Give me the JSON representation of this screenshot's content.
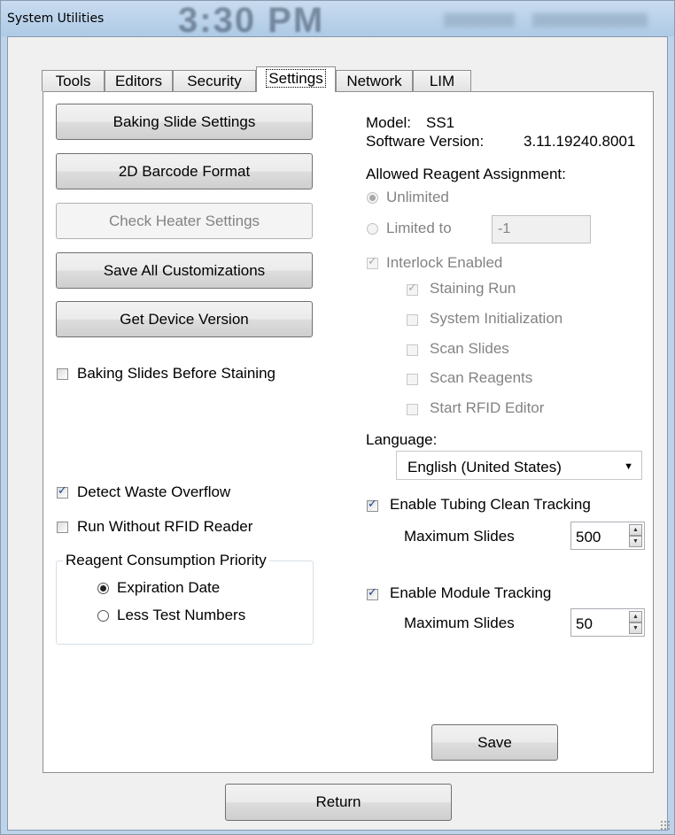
{
  "window": {
    "title": "System Utilities",
    "background_clock": "3:30 PM"
  },
  "tabs": [
    "Tools",
    "Editors",
    "Security",
    "Settings",
    "Network",
    "LIM"
  ],
  "active_tab": "Settings",
  "left": {
    "buttons": {
      "baking_slide_settings": "Baking Slide Settings",
      "barcode_format": "2D Barcode Format",
      "check_heater_settings": "Check Heater Settings",
      "save_all_customizations": "Save All Customizations",
      "get_device_version": "Get Device Version"
    },
    "checkboxes": {
      "baking_slides_before_staining": {
        "label": "Baking Slides Before Staining",
        "checked": false
      },
      "detect_waste_overflow": {
        "label": "Detect Waste Overflow",
        "checked": true
      },
      "run_without_rfid_reader": {
        "label": "Run Without RFID Reader",
        "checked": false
      }
    },
    "reagent_priority": {
      "title": "Reagent Consumption Priority",
      "expiration_date": "Expiration Date",
      "less_test_numbers": "Less Test Numbers",
      "selected": "Expiration Date"
    }
  },
  "right": {
    "model_label": "Model:",
    "model_value": "SS1",
    "software_version_label": "Software Version:",
    "software_version_value": "3.11.19240.8001",
    "allowed_reagent_assignment": "Allowed Reagent Assignment:",
    "unlimited": "Unlimited",
    "limited_to": "Limited to",
    "limited_value": "-1",
    "interlock_enabled": "Interlock Enabled",
    "interlock_items": {
      "staining_run": "Staining Run",
      "system_initialization": "System Initialization",
      "scan_slides": "Scan Slides",
      "scan_reagents": "Scan Reagents",
      "start_rfid_editor": "Start RFID Editor"
    },
    "language_label": "Language:",
    "language_value": "English (United States)",
    "tubing": {
      "label": "Enable Tubing Clean Tracking",
      "max_label": "Maximum Slides",
      "max_value": "500"
    },
    "module": {
      "label": "Enable Module Tracking",
      "max_label": "Maximum Slides",
      "max_value": "50"
    }
  },
  "save_button": "Save",
  "return_button": "Return"
}
